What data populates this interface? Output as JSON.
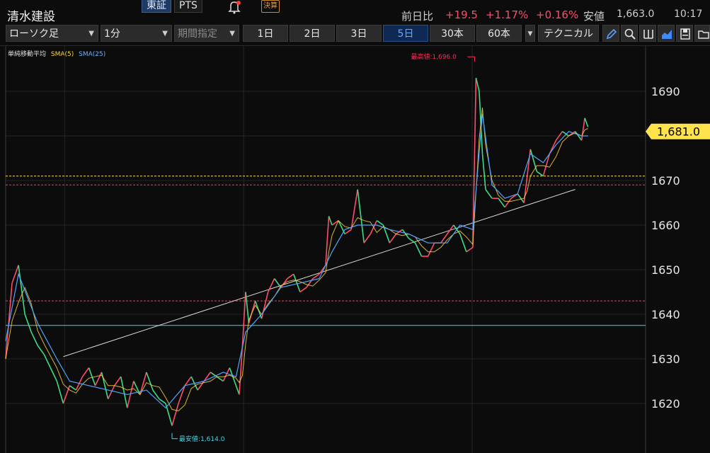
{
  "header": {
    "stock_name": "清水建設",
    "market_buttons": [
      {
        "label": "東証",
        "active": true
      },
      {
        "label": "PTS",
        "active": false
      }
    ],
    "kessan_label": "決算",
    "change_label": "前日比",
    "change_value": "+19.5",
    "change_pct": "+1.17%",
    "change_pct2": "+0.16%",
    "low_label": "安値",
    "low_value": "1,663.0",
    "low_time": "10:17"
  },
  "toolbar": {
    "chart_type": "ローソク足",
    "interval": "1分",
    "range_placeholder": "期間指定",
    "periods": [
      {
        "label": "1日",
        "active": false
      },
      {
        "label": "2日",
        "active": false
      },
      {
        "label": "3日",
        "active": false
      },
      {
        "label": "5日",
        "active": true
      },
      {
        "label": "30本",
        "active": false
      },
      {
        "label": "60本",
        "active": false
      }
    ],
    "technical_label": "テクニカル",
    "icons": [
      "pencil-icon",
      "zoom-icon",
      "grid-icon",
      "area-chart-icon",
      "save-icon",
      "folder-icon"
    ]
  },
  "legend": {
    "indicator": "単純移動平均",
    "sma5": "SMA(5)",
    "sma25": "SMA(25)"
  },
  "colors": {
    "up": "#ff4d6a",
    "down": "#3ddc84",
    "sma5": "#ffd23f",
    "sma25": "#4ea6ff",
    "current_price_bg": "#ffe34d",
    "high_label": "#ff2d55",
    "low_label": "#4fd0e0"
  },
  "chart_data": {
    "type": "line",
    "title": "",
    "ylim": [
      1613,
      1700
    ],
    "yticks": [
      1620,
      1630,
      1640,
      1650,
      1660,
      1670,
      1680,
      1690
    ],
    "current_price_label": "1,681.0",
    "current_price": 1681.0,
    "high_label": "最高値:1,696.0",
    "high_value": 1696.0,
    "low_label": "最安値:1,614.0",
    "low_value": 1614.0,
    "hlines": [
      {
        "value": 1671,
        "color": "#ffe34d",
        "style": "dashed"
      },
      {
        "value": 1669,
        "color": "#ff3a5a",
        "style": "dashed"
      },
      {
        "value": 1643,
        "color": "#ff3a5a",
        "style": "dashed"
      },
      {
        "value": 1637.5,
        "color": "#4fd0e0",
        "style": "solid"
      }
    ],
    "trendline": [
      [
        0.09,
        1630.5
      ],
      [
        0.89,
        1668
      ]
    ],
    "series": [
      {
        "name": "SMA(25)",
        "values": [
          [
            0.0,
            1634
          ],
          [
            0.02,
            1649
          ],
          [
            0.05,
            1638
          ],
          [
            0.08,
            1630
          ],
          [
            0.1,
            1625
          ],
          [
            0.13,
            1624
          ],
          [
            0.16,
            1623
          ],
          [
            0.19,
            1622
          ],
          [
            0.22,
            1623
          ],
          [
            0.25,
            1619
          ],
          [
            0.28,
            1624
          ],
          [
            0.31,
            1625
          ],
          [
            0.34,
            1627
          ],
          [
            0.36,
            1626
          ],
          [
            0.375,
            1636
          ],
          [
            0.4,
            1640
          ],
          [
            0.43,
            1646
          ],
          [
            0.46,
            1647
          ],
          [
            0.49,
            1648
          ],
          [
            0.51,
            1654
          ],
          [
            0.53,
            1659
          ],
          [
            0.55,
            1660
          ],
          [
            0.58,
            1660
          ],
          [
            0.6,
            1659
          ],
          [
            0.63,
            1658
          ],
          [
            0.66,
            1656
          ],
          [
            0.69,
            1656
          ],
          [
            0.71,
            1660
          ],
          [
            0.73,
            1659
          ],
          [
            0.745,
            1685
          ],
          [
            0.76,
            1669
          ],
          [
            0.78,
            1666
          ],
          [
            0.8,
            1667
          ],
          [
            0.82,
            1676
          ],
          [
            0.84,
            1674
          ],
          [
            0.86,
            1678
          ],
          [
            0.88,
            1681
          ],
          [
            0.9,
            1680
          ],
          [
            0.91,
            1680
          ]
        ]
      }
    ],
    "price": [
      [
        0.0,
        1630
      ],
      [
        0.01,
        1647
      ],
      [
        0.02,
        1651
      ],
      [
        0.03,
        1640
      ],
      [
        0.04,
        1636
      ],
      [
        0.05,
        1633
      ],
      [
        0.06,
        1631
      ],
      [
        0.07,
        1628
      ],
      [
        0.08,
        1625
      ],
      [
        0.09,
        1620
      ],
      [
        0.1,
        1624
      ],
      [
        0.11,
        1623
      ],
      [
        0.12,
        1626
      ],
      [
        0.13,
        1628
      ],
      [
        0.14,
        1624
      ],
      [
        0.15,
        1627
      ],
      [
        0.16,
        1621
      ],
      [
        0.17,
        1624
      ],
      [
        0.18,
        1626
      ],
      [
        0.19,
        1619
      ],
      [
        0.2,
        1625
      ],
      [
        0.21,
        1622
      ],
      [
        0.22,
        1627
      ],
      [
        0.23,
        1623
      ],
      [
        0.24,
        1621
      ],
      [
        0.25,
        1620
      ],
      [
        0.26,
        1615
      ],
      [
        0.27,
        1620
      ],
      [
        0.28,
        1624
      ],
      [
        0.29,
        1626
      ],
      [
        0.3,
        1623
      ],
      [
        0.31,
        1625
      ],
      [
        0.32,
        1627
      ],
      [
        0.33,
        1626
      ],
      [
        0.34,
        1625
      ],
      [
        0.35,
        1628
      ],
      [
        0.36,
        1624
      ],
      [
        0.365,
        1622
      ],
      [
        0.37,
        1633
      ],
      [
        0.375,
        1645
      ],
      [
        0.38,
        1638
      ],
      [
        0.39,
        1643
      ],
      [
        0.4,
        1639
      ],
      [
        0.41,
        1645
      ],
      [
        0.42,
        1648
      ],
      [
        0.43,
        1646
      ],
      [
        0.44,
        1648
      ],
      [
        0.45,
        1649
      ],
      [
        0.46,
        1645
      ],
      [
        0.47,
        1646
      ],
      [
        0.48,
        1648
      ],
      [
        0.49,
        1649
      ],
      [
        0.5,
        1651
      ],
      [
        0.505,
        1662
      ],
      [
        0.51,
        1660
      ],
      [
        0.52,
        1661
      ],
      [
        0.53,
        1658
      ],
      [
        0.54,
        1659
      ],
      [
        0.55,
        1668
      ],
      [
        0.56,
        1656
      ],
      [
        0.57,
        1658
      ],
      [
        0.58,
        1661
      ],
      [
        0.59,
        1660
      ],
      [
        0.6,
        1656
      ],
      [
        0.61,
        1658
      ],
      [
        0.62,
        1659
      ],
      [
        0.63,
        1657
      ],
      [
        0.64,
        1656
      ],
      [
        0.65,
        1653
      ],
      [
        0.66,
        1653
      ],
      [
        0.67,
        1656
      ],
      [
        0.68,
        1656
      ],
      [
        0.69,
        1658
      ],
      [
        0.7,
        1660
      ],
      [
        0.71,
        1658
      ],
      [
        0.72,
        1654
      ],
      [
        0.73,
        1655
      ],
      [
        0.735,
        1693
      ],
      [
        0.74,
        1690
      ],
      [
        0.745,
        1676
      ],
      [
        0.75,
        1668
      ],
      [
        0.76,
        1666
      ],
      [
        0.77,
        1666
      ],
      [
        0.78,
        1664
      ],
      [
        0.79,
        1666
      ],
      [
        0.8,
        1667
      ],
      [
        0.81,
        1665
      ],
      [
        0.815,
        1671
      ],
      [
        0.82,
        1677
      ],
      [
        0.83,
        1672
      ],
      [
        0.84,
        1671
      ],
      [
        0.85,
        1676
      ],
      [
        0.86,
        1679
      ],
      [
        0.87,
        1681
      ],
      [
        0.88,
        1680
      ],
      [
        0.89,
        1681
      ],
      [
        0.9,
        1679
      ],
      [
        0.905,
        1684
      ],
      [
        0.91,
        1682
      ]
    ]
  }
}
